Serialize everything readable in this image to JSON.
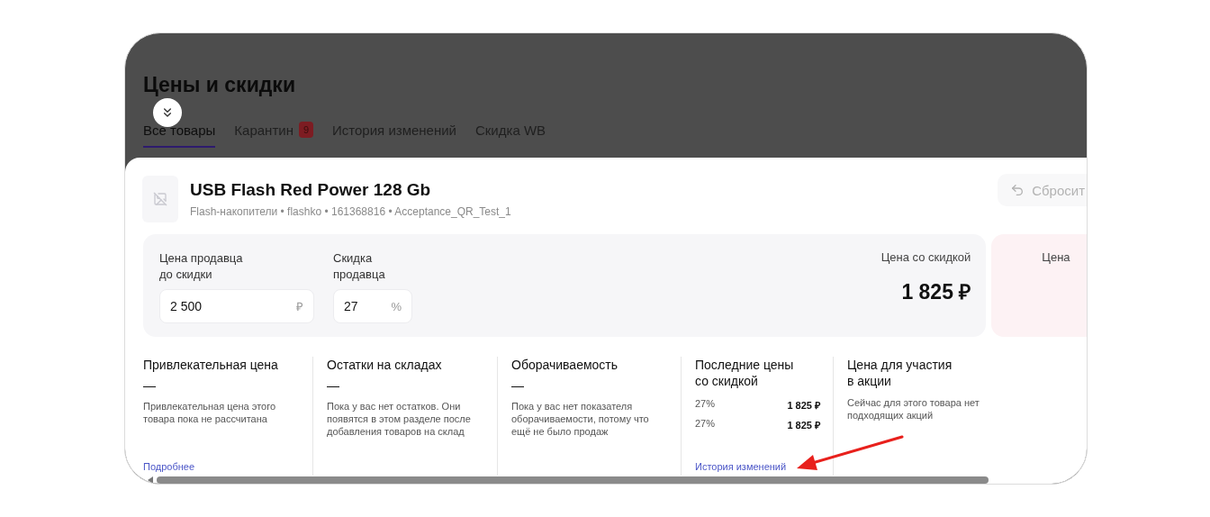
{
  "page": {
    "title": "Цены и скидки"
  },
  "tabs": [
    {
      "label": "Все товары",
      "selected": true
    },
    {
      "label": "Карантин",
      "badge": "9",
      "selected": false
    },
    {
      "label": "История изменений",
      "selected": false
    },
    {
      "label": "Скидка WB",
      "selected": false
    }
  ],
  "product": {
    "name": "USB Flash Red Power 128 Gb",
    "meta": "Flash-накопители • flashko • 161368816 • Acceptance_QR_Test_1"
  },
  "reset_button": {
    "label": "Сбросит"
  },
  "price_fields": [
    {
      "label": "Цена продавца до скидки",
      "value": "2 500",
      "unit": "₽"
    },
    {
      "label": "Скидка продавца",
      "value": "27",
      "unit": "%"
    }
  ],
  "discounted_price": {
    "label": "Цена со скидкой",
    "value": "1 825 ₽"
  },
  "side_panel": {
    "label": "Цена"
  },
  "info_columns": [
    {
      "kind": "text",
      "title": "Привлекательная цена",
      "value": "—",
      "text": "Привлекательная цена этого товара пока не рассчитана",
      "link": "Подробнее"
    },
    {
      "kind": "text",
      "title": "Остатки на складах",
      "value": "—",
      "text": "Пока у вас нет остатков. Они появятся в этом разделе после добавления товаров на склад"
    },
    {
      "kind": "text",
      "title": "Оборачиваемость",
      "value": "—",
      "text": "Пока у вас нет показателя оборачиваемости, потому что ещё не было продаж"
    },
    {
      "kind": "history",
      "title": "Последние цены со скидкой",
      "rows": [
        {
          "discount": "27%",
          "price": "1 825 ₽"
        },
        {
          "discount": "27%",
          "price": "1 825 ₽"
        }
      ],
      "link": "История изменений"
    },
    {
      "kind": "text",
      "title": "Цена для участия в акции",
      "text": "Сейчас для этого товара нет подходящих акций"
    }
  ]
}
